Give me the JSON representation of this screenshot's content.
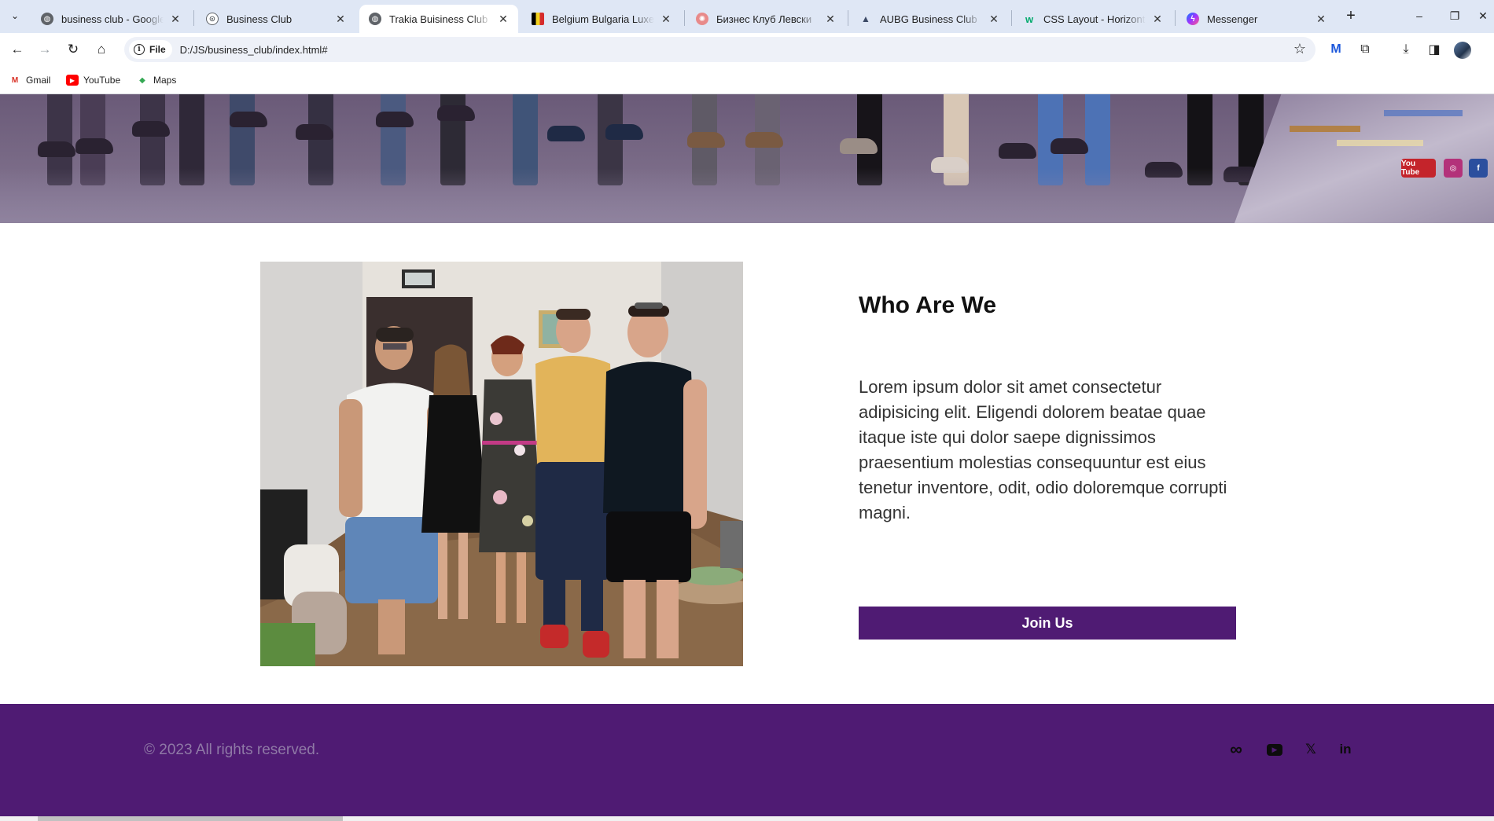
{
  "browser": {
    "tabs": [
      {
        "title": "business club - Google Търсене",
        "favicon": "globe-icon",
        "close": "✕"
      },
      {
        "title": "Business Club",
        "favicon": "globe-icon",
        "close": "✕"
      },
      {
        "title": "Trakia Buisiness Club",
        "favicon": "globe-icon",
        "close": "✕"
      },
      {
        "title": "Belgium Bulgaria Luxembourg",
        "favicon": "flag-icon",
        "close": "✕"
      },
      {
        "title": "Бизнес Клуб Левски",
        "favicon": "club-logo-icon",
        "close": "✕"
      },
      {
        "title": "AUBG Business Club",
        "favicon": "aubg-logo-icon",
        "close": "✕"
      },
      {
        "title": "CSS Layout - Horizontal & Vertical",
        "favicon": "w3schools-icon",
        "close": "✕"
      },
      {
        "title": "Messenger",
        "favicon": "messenger-icon",
        "close": "✕"
      }
    ],
    "active_tab_index": 2,
    "new_tab_label": "+",
    "window_controls": {
      "minimize": "–",
      "restore": "❐",
      "close": "✕"
    },
    "address_bar": {
      "chip_label": "File",
      "chip_icon": "i",
      "url": "D:/JS/business_club/index.html#"
    },
    "nav": {
      "back": "←",
      "forward": "→",
      "reload": "↻",
      "home": "⌂"
    },
    "toolbar_icons": {
      "star": "☆",
      "extension_m": "M",
      "extensions": "⧉",
      "download": "⤓",
      "sidepanel": "◨"
    },
    "bookmarks": [
      {
        "label": "Gmail",
        "icon": "M",
        "color": "#d93025"
      },
      {
        "label": "YouTube",
        "icon": "▶",
        "color": "#ff0000"
      },
      {
        "label": "Maps",
        "icon": "◆",
        "color": "#34a853"
      }
    ]
  },
  "page": {
    "about": {
      "title": "Who Are We",
      "text": "Lorem ipsum dolor sit amet consectetur adipisicing elit. Eligendi dolorem beatae quae itaque iste qui dolor saepe dignissimos praesentium molestias consequuntur est eius tenetur inventore, odit, odio doloremque corrupti magni.",
      "button": "Join Us"
    },
    "footer": {
      "copyright": "© 2023 All rights reserved.",
      "social": [
        {
          "name": "meta",
          "glyph": "∞"
        },
        {
          "name": "youtube",
          "glyph": "▶"
        },
        {
          "name": "x",
          "glyph": "𝕏"
        },
        {
          "name": "linkedin",
          "glyph": "in"
        }
      ]
    },
    "hero_social": [
      "You Tube",
      "◎",
      "f"
    ]
  },
  "colors": {
    "brand_purple": "#4f1b73",
    "footer_text": "#8f79a6",
    "tabstrip": "#dfe7f5",
    "omnibox": "#eef1f8"
  }
}
